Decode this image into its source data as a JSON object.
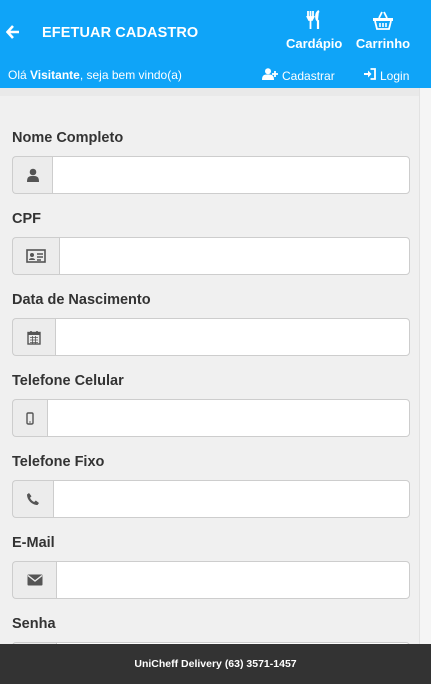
{
  "header": {
    "title": "EFETUAR CADASTRO",
    "back_icon": "arrow-left-icon",
    "nav": [
      {
        "label": "Cardápio",
        "icon": "cutlery-icon"
      },
      {
        "label": "Carrinho",
        "icon": "basket-icon"
      }
    ],
    "greeting": {
      "prefix": "Olá ",
      "name": "Visitante",
      "suffix": ", seja bem vindo(a)"
    },
    "actions": [
      {
        "label": "Cadastrar",
        "icon": "user-plus-icon"
      },
      {
        "label": "Login",
        "icon": "sign-in-icon"
      }
    ],
    "color": "#0fa4f8"
  },
  "form": {
    "fields": [
      {
        "label": "Nome Completo",
        "icon": "user-icon",
        "value": "",
        "placeholder": ""
      },
      {
        "label": "CPF",
        "icon": "id-card-icon",
        "value": "",
        "placeholder": ""
      },
      {
        "label": "Data de Nascimento",
        "icon": "calendar-icon",
        "value": "",
        "placeholder": ""
      },
      {
        "label": "Telefone Celular",
        "icon": "mobile-phone-icon",
        "value": "",
        "placeholder": ""
      },
      {
        "label": "Telefone Fixo",
        "icon": "phone-icon",
        "value": "",
        "placeholder": ""
      },
      {
        "label": "E-Mail",
        "icon": "envelope-icon",
        "value": "",
        "placeholder": ""
      },
      {
        "label": "Senha",
        "icon": "lock-icon",
        "value": "",
        "placeholder": ""
      }
    ]
  },
  "footer": {
    "text": "UniCheff Delivery (63) 3571-1457",
    "color": "#333333"
  }
}
